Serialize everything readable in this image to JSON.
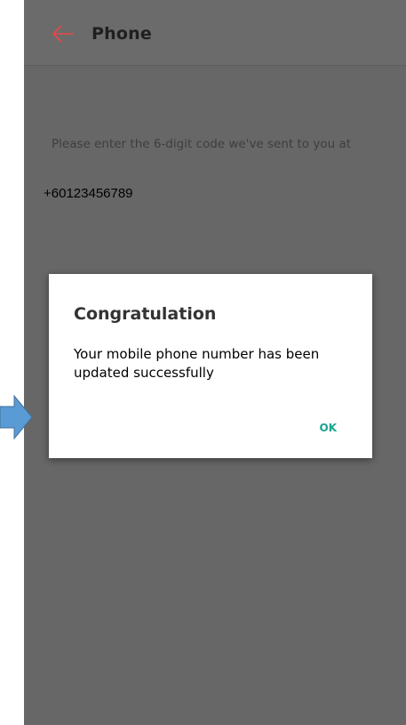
{
  "appbar": {
    "title": "Phone",
    "back_icon": "arrow-left-icon",
    "back_icon_color": "#e8474b"
  },
  "content": {
    "instruction": "Please enter the 6-digit code we've sent to you at",
    "phone_number": "+60123456789"
  },
  "dialog": {
    "title": "Congratulation",
    "message": "Your mobile phone number has been updated successfully",
    "ok_label": "OK",
    "ok_color": "#1aa38f"
  },
  "annotation": {
    "arrow_icon": "arrow-right-icon",
    "arrow_color": "#5b9bd5"
  }
}
